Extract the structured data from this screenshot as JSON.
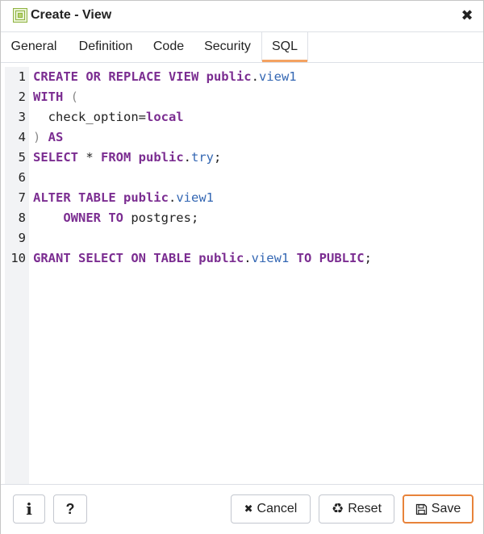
{
  "dialog": {
    "title": "Create - View"
  },
  "tabs": [
    {
      "label": "General",
      "active": false
    },
    {
      "label": "Definition",
      "active": false
    },
    {
      "label": "Code",
      "active": false
    },
    {
      "label": "Security",
      "active": false
    },
    {
      "label": "SQL",
      "active": true
    }
  ],
  "sql": {
    "line_numbers": [
      "1",
      "2",
      "3",
      "4",
      "5",
      "6",
      "7",
      "8",
      "9",
      "10"
    ],
    "lines": [
      [
        {
          "t": "CREATE OR REPLACE VIEW public",
          "c": "kw"
        },
        {
          "t": ".",
          "c": "plain"
        },
        {
          "t": "view1",
          "c": "ident"
        }
      ],
      [
        {
          "t": "WITH",
          "c": "kw"
        },
        {
          "t": " (",
          "c": "punc"
        }
      ],
      [
        {
          "t": "  check_option=",
          "c": "plain"
        },
        {
          "t": "local",
          "c": "kw"
        }
      ],
      [
        {
          "t": ")",
          "c": "punc"
        },
        {
          "t": " AS",
          "c": "kw"
        }
      ],
      [
        {
          "t": "SELECT",
          "c": "kw"
        },
        {
          "t": " * ",
          "c": "plain"
        },
        {
          "t": "FROM public",
          "c": "kw"
        },
        {
          "t": ".",
          "c": "plain"
        },
        {
          "t": "try",
          "c": "ident"
        },
        {
          "t": ";",
          "c": "plain"
        }
      ],
      [],
      [
        {
          "t": "ALTER TABLE public",
          "c": "kw"
        },
        {
          "t": ".",
          "c": "plain"
        },
        {
          "t": "view1",
          "c": "ident"
        }
      ],
      [
        {
          "t": "    ",
          "c": "plain"
        },
        {
          "t": "OWNER TO",
          "c": "kw"
        },
        {
          "t": " postgres;",
          "c": "plain"
        }
      ],
      [],
      [
        {
          "t": "GRANT SELECT ON TABLE public",
          "c": "kw"
        },
        {
          "t": ".",
          "c": "plain"
        },
        {
          "t": "view1",
          "c": "ident"
        },
        {
          "t": " ",
          "c": "plain"
        },
        {
          "t": "TO PUBLIC",
          "c": "kw"
        },
        {
          "t": ";",
          "c": "plain"
        }
      ]
    ]
  },
  "footer": {
    "info_label": "i",
    "help_label": "?",
    "cancel_label": "Cancel",
    "reset_label": "Reset",
    "save_label": "Save"
  },
  "colors": {
    "accent": "#e8833a",
    "keyword": "#7b2d91",
    "identifier": "#3467b3"
  }
}
